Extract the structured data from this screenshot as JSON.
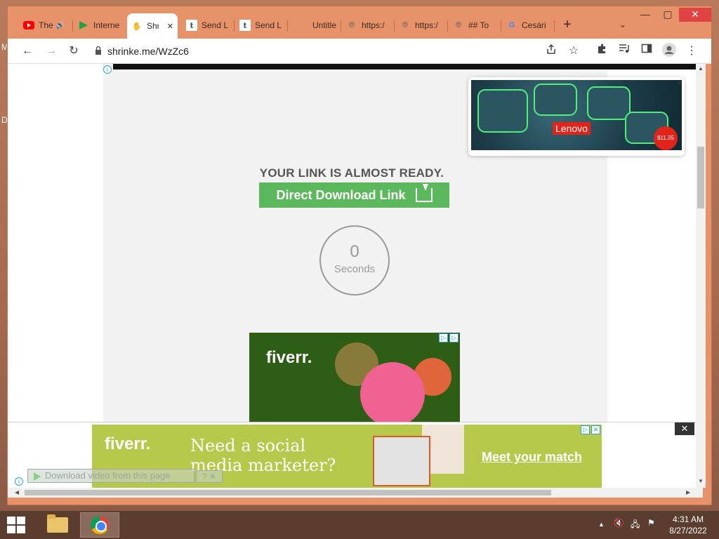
{
  "desktop": {
    "glyph_top": "M",
    "glyph_mid": "D"
  },
  "tabs": [
    {
      "label": "The",
      "icon": "youtube-icon",
      "audio": "🔊"
    },
    {
      "label": "Interne",
      "icon": "play-icon"
    },
    {
      "label": "Shr",
      "icon": "hand-icon",
      "active": true,
      "close": "✕"
    },
    {
      "label": "Send L",
      "icon": "tumblr-icon"
    },
    {
      "label": "Send L",
      "icon": "tumblr-icon"
    },
    {
      "label": "Untitle",
      "icon": "blank-icon"
    },
    {
      "label": "https:/",
      "icon": "globe-icon"
    },
    {
      "label": "https:/",
      "icon": "globe-icon"
    },
    {
      "label": "## To",
      "icon": "globe-icon"
    },
    {
      "label": "Cesári",
      "icon": "google-icon"
    }
  ],
  "new_tab": "+",
  "tab_search": "⌄",
  "window_controls": {
    "minimize": "—",
    "maximize": "▢",
    "close": "✕"
  },
  "toolbar": {
    "back": "←",
    "forward": "→",
    "reload": "↻",
    "url": "shrinke.me/WzZc6"
  },
  "page": {
    "title": "YOUR LINK IS ALMOST READY.",
    "download_button": "Direct Download Link",
    "timer_value": "0",
    "timer_unit": "Seconds"
  },
  "ads": {
    "lenovo": {
      "brand": "Lenovo",
      "price": "$11.35",
      "close": "x"
    },
    "fiverr_mid": {
      "brand": "fiverr."
    },
    "bottom": {
      "brand": "fiverr.",
      "headline": "Need a social media marketer?",
      "cta": "Meet your match",
      "close": "✕"
    },
    "download_video": "Download video from this page",
    "download_video_help": "? ✕"
  },
  "taskbar": {
    "time": "4:31 AM",
    "date": "8/27/2022",
    "tray_up": "▲",
    "volume": "🔇",
    "network": "🖧",
    "flag": "⚑"
  }
}
